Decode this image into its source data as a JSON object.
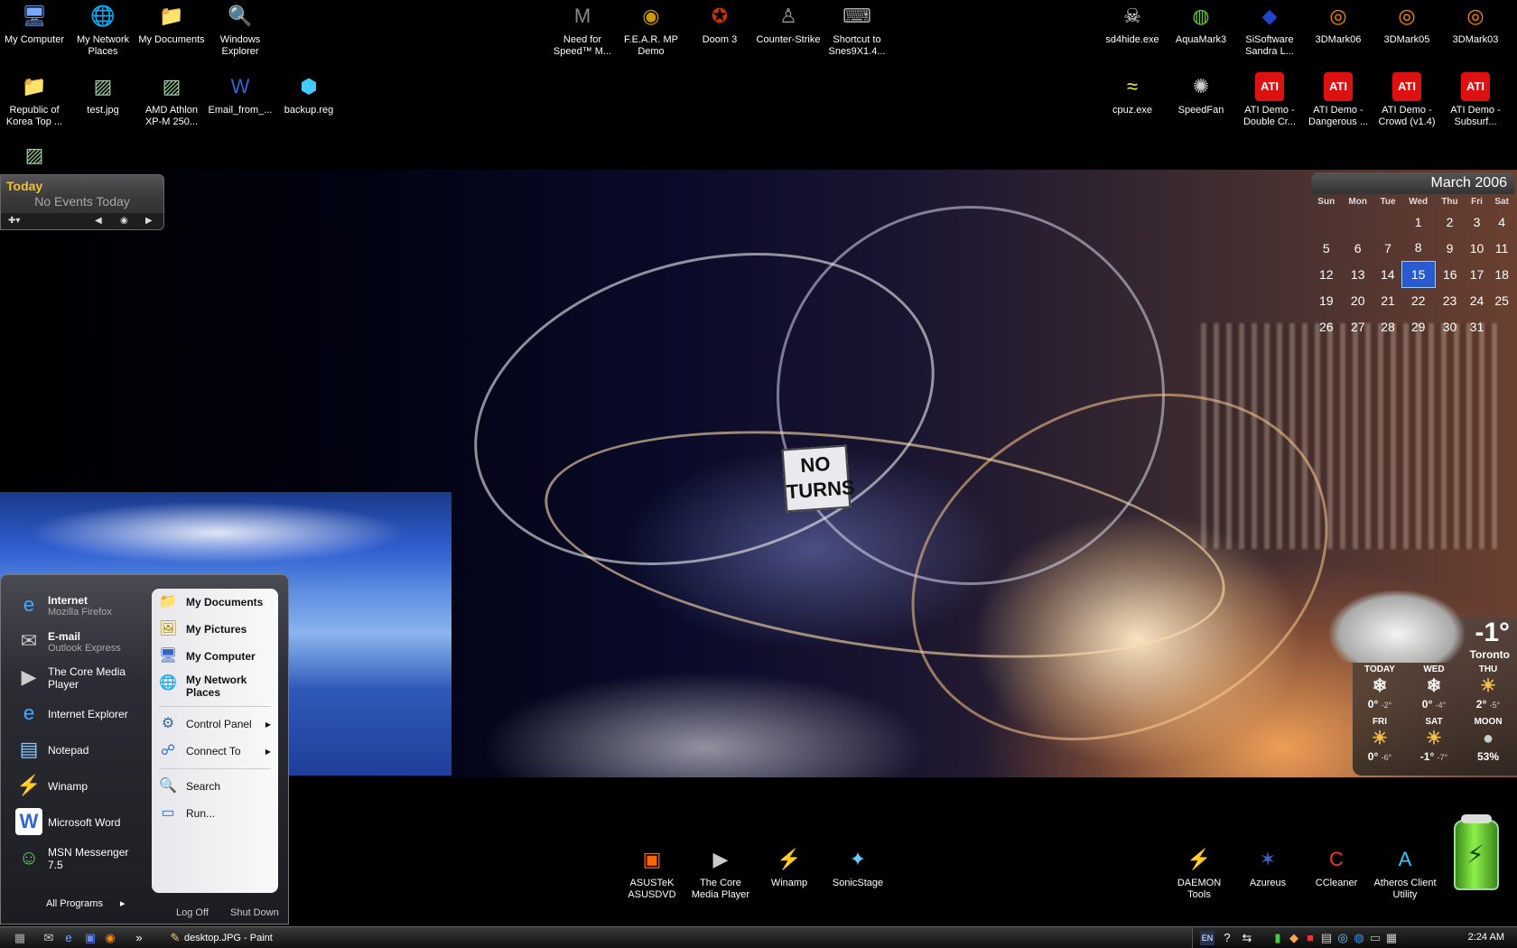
{
  "desktop": {
    "top_left": [
      {
        "label": "My Computer",
        "icon": "computer-icon"
      },
      {
        "label": "My Network Places",
        "icon": "network-icon"
      },
      {
        "label": "My Documents",
        "icon": "folder-icon"
      },
      {
        "label": "Windows Explorer",
        "icon": "explorer-icon"
      },
      {
        "label": "Republic of Korea Top ...",
        "icon": "folder-icon"
      },
      {
        "label": "test.jpg",
        "icon": "image-file-icon"
      },
      {
        "label": "AMD Athlon XP-M 250...",
        "icon": "image-file-icon"
      },
      {
        "label": "Email_from_...",
        "icon": "word-doc-icon"
      },
      {
        "label": "backup.reg",
        "icon": "registry-file-icon"
      }
    ],
    "top_middle": [
      {
        "label": "Need for Speed™ M...",
        "icon": "nfs-icon"
      },
      {
        "label": "F.E.A.R. MP Demo",
        "icon": "fear-icon"
      },
      {
        "label": "Doom 3",
        "icon": "doom-icon"
      },
      {
        "label": "Counter-Strike",
        "icon": "counter-strike-icon"
      },
      {
        "label": "Shortcut to Snes9X1.4...",
        "icon": "gamepad-icon"
      }
    ],
    "top_right": [
      {
        "label": "sd4hide.exe",
        "icon": "skull-icon"
      },
      {
        "label": "AquaMark3",
        "icon": "aquamark-icon"
      },
      {
        "label": "SiSoftware Sandra L...",
        "icon": "sandra-icon"
      },
      {
        "label": "3DMark06",
        "icon": "3dmark-icon"
      },
      {
        "label": "3DMark05",
        "icon": "3dmark-icon"
      },
      {
        "label": "3DMark03",
        "icon": "3dmark-icon"
      },
      {
        "label": "cpuz.exe",
        "icon": "cpuz-icon"
      },
      {
        "label": "SpeedFan",
        "icon": "fan-icon"
      },
      {
        "label": "ATI Demo - Double Cr...",
        "icon": "ati-icon"
      },
      {
        "label": "ATI Demo - Dangerous ...",
        "icon": "ati-icon"
      },
      {
        "label": "ATI Demo - Crowd (v1.4)",
        "icon": "ati-icon"
      },
      {
        "label": "ATI Demo - Subsurf...",
        "icon": "ati-icon"
      }
    ],
    "bottom": [
      {
        "label": "ASUSTeK ASUSDVD",
        "icon": "asusdvd-icon"
      },
      {
        "label": "The Core Media Player",
        "icon": "media-player-icon"
      },
      {
        "label": "Winamp",
        "icon": "winamp-icon"
      },
      {
        "label": "SonicStage",
        "icon": "sonicstage-icon"
      },
      {
        "label": "DAEMON Tools",
        "icon": "daemon-tools-icon"
      },
      {
        "label": "Azureus",
        "icon": "azureus-icon"
      },
      {
        "label": "CCleaner",
        "icon": "ccleaner-icon"
      },
      {
        "label": "Atheros Client Utility",
        "icon": "atheros-icon"
      }
    ],
    "sign_text": "NO TURNS"
  },
  "today_gadget": {
    "title": "Today",
    "events": "No Events Today"
  },
  "calendar": {
    "title": "March 2006",
    "weekdays": [
      "Sun",
      "Mon",
      "Tue",
      "Wed",
      "Thu",
      "Fri",
      "Sat"
    ],
    "weeks": [
      [
        "",
        "",
        "",
        "1",
        "2",
        "3",
        "4"
      ],
      [
        "5",
        "6",
        "7",
        "8",
        "9",
        "10",
        "11"
      ],
      [
        "12",
        "13",
        "14",
        "15",
        "16",
        "17",
        "18"
      ],
      [
        "19",
        "20",
        "21",
        "22",
        "23",
        "24",
        "25"
      ],
      [
        "26",
        "27",
        "28",
        "29",
        "30",
        "31",
        ""
      ]
    ],
    "selected": "15"
  },
  "weather": {
    "current_temp": "-1°",
    "city": "Toronto",
    "forecast": [
      {
        "day": "TODAY",
        "hi": "0°",
        "lo": "-2°",
        "icon": "snow-icon"
      },
      {
        "day": "WED",
        "hi": "0°",
        "lo": "-4°",
        "icon": "snow-icon"
      },
      {
        "day": "THU",
        "hi": "2°",
        "lo": "-5°",
        "icon": "partly-sunny-icon"
      },
      {
        "day": "FRI",
        "hi": "0°",
        "lo": "-6°",
        "icon": "partly-sunny-icon"
      },
      {
        "day": "SAT",
        "hi": "-1°",
        "lo": "-7°",
        "icon": "partly-sunny-icon"
      }
    ],
    "moon_label": "MOON",
    "moon_value": "53%"
  },
  "start_menu": {
    "pinned": [
      {
        "title": "Internet",
        "subtitle": "Mozilla Firefox",
        "icon": "internet-icon"
      },
      {
        "title": "E-mail",
        "subtitle": "Outlook Express",
        "icon": "email-icon"
      }
    ],
    "recent": [
      {
        "label": "The Core Media Player",
        "icon": "media-player-icon"
      },
      {
        "label": "Internet Explorer",
        "icon": "ie-icon"
      },
      {
        "label": "Notepad",
        "icon": "notepad-icon"
      },
      {
        "label": "Winamp",
        "icon": "winamp-icon"
      },
      {
        "label": "Microsoft Word",
        "icon": "word-icon"
      },
      {
        "label": "MSN Messenger 7.5",
        "icon": "msn-icon"
      }
    ],
    "all_programs": "All Programs",
    "right_items": [
      {
        "label": "My Documents",
        "bold": true
      },
      {
        "label": "My Pictures",
        "bold": true
      },
      {
        "label": "My Computer",
        "bold": true
      },
      {
        "label": "My Network Places",
        "bold": true
      },
      {
        "label": "Control Panel",
        "bold": false
      },
      {
        "label": "Connect To",
        "bold": false
      },
      {
        "label": "Search",
        "bold": false
      },
      {
        "label": "Run...",
        "bold": false
      }
    ],
    "log_off": "Log Off",
    "shut_down": "Shut Down"
  },
  "taskbar": {
    "task_label": "desktop.JPG - Paint",
    "lang": "EN",
    "clock": "2:24 AM"
  },
  "colors": {
    "calendar_selected": "#2a5ad0",
    "today_title": "#f0c040",
    "battery": "#8ef04a"
  }
}
